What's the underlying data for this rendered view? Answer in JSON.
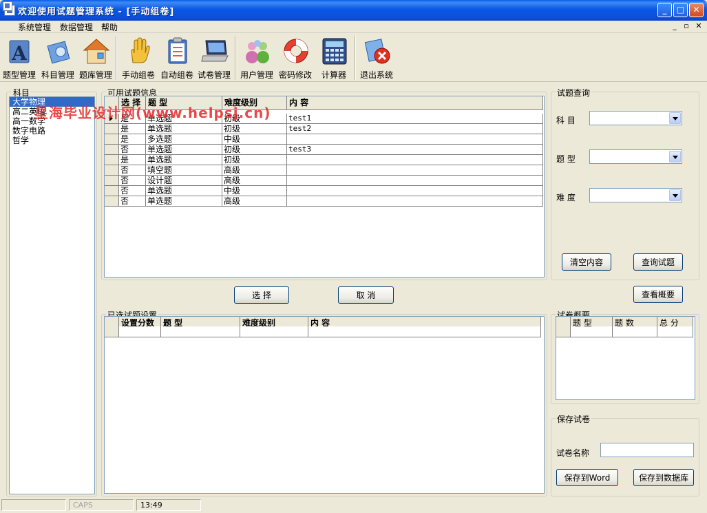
{
  "window": {
    "title": "欢迎使用试题管理系统 - [手动组卷]"
  },
  "menu": {
    "items": [
      "系统管理",
      "数据管理",
      "帮助"
    ]
  },
  "toolbar": {
    "items": [
      {
        "label": "题型管理",
        "icon": "question-type-icon"
      },
      {
        "label": "科目管理",
        "icon": "subject-icon"
      },
      {
        "label": "题库管理",
        "icon": "question-bank-icon"
      },
      {
        "label": "手动组卷",
        "icon": "hand-icon"
      },
      {
        "label": "自动组卷",
        "icon": "clipboard-icon"
      },
      {
        "label": "试卷管理",
        "icon": "laptop-icon"
      },
      {
        "label": "用户管理",
        "icon": "users-icon"
      },
      {
        "label": "密码修改",
        "icon": "lifebuoy-icon"
      },
      {
        "label": "计算器",
        "icon": "calculator-icon"
      },
      {
        "label": "退出系统",
        "icon": "exit-icon"
      }
    ]
  },
  "subjects": {
    "title": "科目",
    "items": [
      "大学物理",
      "高二英语",
      "高一数学",
      "数字电路",
      "哲学"
    ],
    "selected": 0
  },
  "available": {
    "title": "可用试题信息",
    "columns": [
      "选 择",
      "题  型",
      "难度级别",
      "内   容"
    ],
    "rows": [
      [
        "是",
        "单选题",
        "初级",
        "test1"
      ],
      [
        "是",
        "单选题",
        "初级",
        "test2"
      ],
      [
        "是",
        "多选题",
        "中级",
        ""
      ],
      [
        "否",
        "单选题",
        "初级",
        "test3"
      ],
      [
        "是",
        "单选题",
        "初级",
        ""
      ],
      [
        "否",
        "填空题",
        "高级",
        ""
      ],
      [
        "否",
        "设计题",
        "高级",
        ""
      ],
      [
        "否",
        "单选题",
        "中级",
        ""
      ],
      [
        "否",
        "单选题",
        "高级",
        ""
      ]
    ]
  },
  "actions": {
    "select": "选  择",
    "cancel": "取  消",
    "overview": "查看概要"
  },
  "selected_settings": {
    "title": "已选试题设置",
    "columns": [
      "设置分数",
      "题  型",
      "难度级别",
      "内   容"
    ]
  },
  "query": {
    "title": "试题查询",
    "subject_label": "科  目",
    "type_label": "题  型",
    "difficulty_label": "难  度",
    "clear": "清空内容",
    "search": "查询试题"
  },
  "summary": {
    "title": "试卷概要",
    "columns": [
      "题 型",
      "题 数",
      "总 分"
    ]
  },
  "save": {
    "title": "保存试卷",
    "name_label": "试卷名称",
    "to_word": "保存到Word",
    "to_db": "保存到数据库"
  },
  "status": {
    "caps": "CAPS",
    "time": "13:49"
  },
  "watermark": "星海毕业设计网(www.helpsj.cn)"
}
